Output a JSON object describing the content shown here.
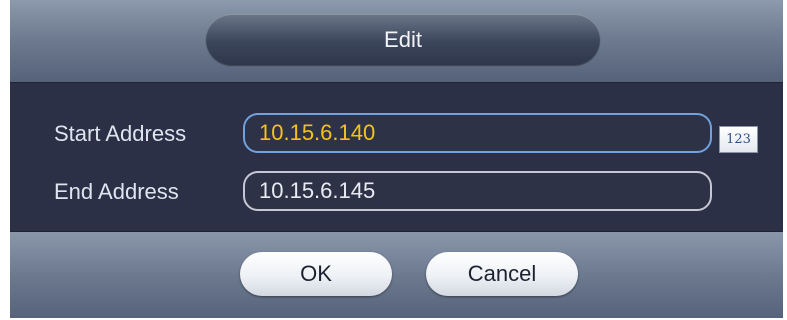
{
  "dialog": {
    "title": "Edit"
  },
  "form": {
    "start_label": "Start Address",
    "start_value": "10.15.6.140",
    "end_label": "End Address",
    "end_value": "10.15.6.145",
    "keypad_label": "123"
  },
  "buttons": {
    "ok_label": "OK",
    "cancel_label": "Cancel"
  },
  "colors": {
    "active_value": "#f5c21b",
    "active_border": "#6fa2de",
    "panel_background": "#2b3046"
  }
}
